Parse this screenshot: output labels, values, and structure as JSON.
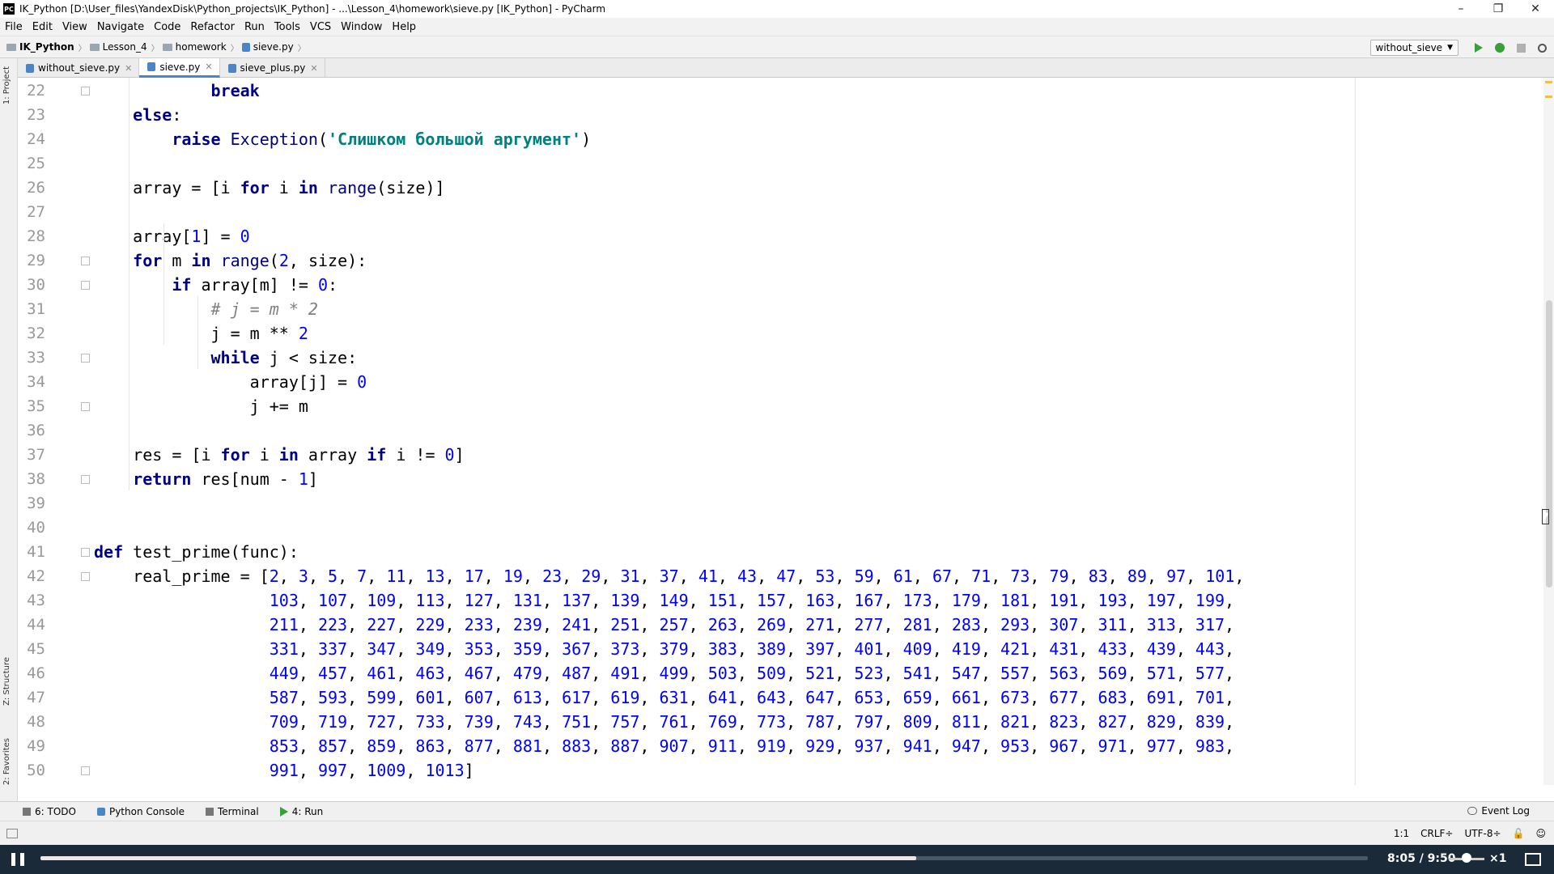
{
  "window": {
    "app_icon": "PC",
    "title": "IK_Python [D:\\User_files\\YandexDisk\\Python_projects\\IK_Python] - ...\\Lesson_4\\homework\\sieve.py [IK_Python] - PyCharm",
    "minimize": "–",
    "restore": "❐",
    "close": "✕"
  },
  "menu": [
    "File",
    "Edit",
    "View",
    "Navigate",
    "Code",
    "Refactor",
    "Run",
    "Tools",
    "VCS",
    "Window",
    "Help"
  ],
  "breadcrumb": {
    "items": [
      "IK_Python",
      "Lesson_4",
      "homework",
      "sieve.py"
    ]
  },
  "run_config": {
    "label": "without_sieve"
  },
  "tabs": [
    {
      "label": "without_sieve.py",
      "active": false
    },
    {
      "label": "sieve.py",
      "active": true
    },
    {
      "label": "sieve_plus.py",
      "active": false
    }
  ],
  "side_panels": {
    "project": "1: Project",
    "structure": "Z: Structure",
    "favorites": "2: Favorites"
  },
  "code_lines": [
    {
      "n": "22",
      "html": "                <span class=\"kw\">break</span>"
    },
    {
      "n": "23",
      "html": "        <span class=\"kw\">else</span>:"
    },
    {
      "n": "24",
      "html": "            <span class=\"kw\">raise</span> <span class=\"bi\">Exception</span>(<span class=\"str\">'Слишком большой аргумент'</span>)"
    },
    {
      "n": "25",
      "html": ""
    },
    {
      "n": "26",
      "html": "        array = [i <span class=\"kw\">for</span> i <span class=\"kw\">in</span> <span class=\"bi\">range</span>(size)]"
    },
    {
      "n": "27",
      "html": ""
    },
    {
      "n": "28",
      "html": "        array[<span class=\"num\">1</span>] = <span class=\"num\">0</span>"
    },
    {
      "n": "29",
      "html": "        <span class=\"kw\">for</span> m <span class=\"kw\">in</span> <span class=\"bi\">range</span>(<span class=\"num\">2</span>, size):"
    },
    {
      "n": "30",
      "html": "            <span class=\"kw\">if</span> array[m] != <span class=\"num\">0</span>:"
    },
    {
      "n": "31",
      "html": "                <span class=\"cmt\"># j = m * 2</span>"
    },
    {
      "n": "32",
      "html": "                j = m ** <span class=\"num\">2</span>"
    },
    {
      "n": "33",
      "html": "                <span class=\"kw\">while</span> j &lt; size:"
    },
    {
      "n": "34",
      "html": "                    array[j] = <span class=\"num\">0</span>"
    },
    {
      "n": "35",
      "html": "                    j += m"
    },
    {
      "n": "36",
      "html": ""
    },
    {
      "n": "37",
      "html": "        res = [i <span class=\"kw\">for</span> i <span class=\"kw\">in</span> array <span class=\"kw\">if</span> i != <span class=\"num\">0</span>]"
    },
    {
      "n": "38",
      "html": "        <span class=\"kw\">return</span> res[num - <span class=\"num\">1</span>]"
    },
    {
      "n": "39",
      "html": ""
    },
    {
      "n": "40",
      "html": ""
    },
    {
      "n": "41",
      "html": "    <span class=\"kw\">def</span> test_prime(func):"
    },
    {
      "n": "42",
      "html": "        real_prime = [<span class=\"num\">2</span>, <span class=\"num\">3</span>, <span class=\"num\">5</span>, <span class=\"num\">7</span>, <span class=\"num\">11</span>, <span class=\"num\">13</span>, <span class=\"num\">17</span>, <span class=\"num\">19</span>, <span class=\"num\">23</span>, <span class=\"num\">29</span>, <span class=\"num\">31</span>, <span class=\"num\">37</span>, <span class=\"num\">41</span>, <span class=\"num\">43</span>, <span class=\"num\">47</span>, <span class=\"num\">53</span>, <span class=\"num\">59</span>, <span class=\"num\">61</span>, <span class=\"num\">67</span>, <span class=\"num\">71</span>, <span class=\"num\">73</span>, <span class=\"num\">79</span>, <span class=\"num\">83</span>, <span class=\"num\">89</span>, <span class=\"num\">97</span>, <span class=\"num\">101</span>,"
    },
    {
      "n": "43",
      "html": "                      <span class=\"num\">103</span>, <span class=\"num\">107</span>, <span class=\"num\">109</span>, <span class=\"num\">113</span>, <span class=\"num\">127</span>, <span class=\"num\">131</span>, <span class=\"num\">137</span>, <span class=\"num\">139</span>, <span class=\"num\">149</span>, <span class=\"num\">151</span>, <span class=\"num\">157</span>, <span class=\"num\">163</span>, <span class=\"num\">167</span>, <span class=\"num\">173</span>, <span class=\"num\">179</span>, <span class=\"num\">181</span>, <span class=\"num\">191</span>, <span class=\"num\">193</span>, <span class=\"num\">197</span>, <span class=\"num\">199</span>,"
    },
    {
      "n": "44",
      "html": "                      <span class=\"num\">211</span>, <span class=\"num\">223</span>, <span class=\"num\">227</span>, <span class=\"num\">229</span>, <span class=\"num\">233</span>, <span class=\"num\">239</span>, <span class=\"num\">241</span>, <span class=\"num\">251</span>, <span class=\"num\">257</span>, <span class=\"num\">263</span>, <span class=\"num\">269</span>, <span class=\"num\">271</span>, <span class=\"num\">277</span>, <span class=\"num\">281</span>, <span class=\"num\">283</span>, <span class=\"num\">293</span>, <span class=\"num\">307</span>, <span class=\"num\">311</span>, <span class=\"num\">313</span>, <span class=\"num\">317</span>,"
    },
    {
      "n": "45",
      "html": "                      <span class=\"num\">331</span>, <span class=\"num\">337</span>, <span class=\"num\">347</span>, <span class=\"num\">349</span>, <span class=\"num\">353</span>, <span class=\"num\">359</span>, <span class=\"num\">367</span>, <span class=\"num\">373</span>, <span class=\"num\">379</span>, <span class=\"num\">383</span>, <span class=\"num\">389</span>, <span class=\"num\">397</span>, <span class=\"num\">401</span>, <span class=\"num\">409</span>, <span class=\"num\">419</span>, <span class=\"num\">421</span>, <span class=\"num\">431</span>, <span class=\"num\">433</span>, <span class=\"num\">439</span>, <span class=\"num\">443</span>,"
    },
    {
      "n": "46",
      "html": "                      <span class=\"num\">449</span>, <span class=\"num\">457</span>, <span class=\"num\">461</span>, <span class=\"num\">463</span>, <span class=\"num\">467</span>, <span class=\"num\">479</span>, <span class=\"num\">487</span>, <span class=\"num\">491</span>, <span class=\"num\">499</span>, <span class=\"num\">503</span>, <span class=\"num\">509</span>, <span class=\"num\">521</span>, <span class=\"num\">523</span>, <span class=\"num\">541</span>, <span class=\"num\">547</span>, <span class=\"num\">557</span>, <span class=\"num\">563</span>, <span class=\"num\">569</span>, <span class=\"num\">571</span>, <span class=\"num\">577</span>,"
    },
    {
      "n": "47",
      "html": "                      <span class=\"num\">587</span>, <span class=\"num\">593</span>, <span class=\"num\">599</span>, <span class=\"num\">601</span>, <span class=\"num\">607</span>, <span class=\"num\">613</span>, <span class=\"num\">617</span>, <span class=\"num\">619</span>, <span class=\"num\">631</span>, <span class=\"num\">641</span>, <span class=\"num\">643</span>, <span class=\"num\">647</span>, <span class=\"num\">653</span>, <span class=\"num\">659</span>, <span class=\"num\">661</span>, <span class=\"num\">673</span>, <span class=\"num\">677</span>, <span class=\"num\">683</span>, <span class=\"num\">691</span>, <span class=\"num\">701</span>,"
    },
    {
      "n": "48",
      "html": "                      <span class=\"num\">709</span>, <span class=\"num\">719</span>, <span class=\"num\">727</span>, <span class=\"num\">733</span>, <span class=\"num\">739</span>, <span class=\"num\">743</span>, <span class=\"num\">751</span>, <span class=\"num\">757</span>, <span class=\"num\">761</span>, <span class=\"num\">769</span>, <span class=\"num\">773</span>, <span class=\"num\">787</span>, <span class=\"num\">797</span>, <span class=\"num\">809</span>, <span class=\"num\">811</span>, <span class=\"num\">821</span>, <span class=\"num\">823</span>, <span class=\"num\">827</span>, <span class=\"num\">829</span>, <span class=\"num\">839</span>,"
    },
    {
      "n": "49",
      "html": "                      <span class=\"num\">853</span>, <span class=\"num\">857</span>, <span class=\"num\">859</span>, <span class=\"num\">863</span>, <span class=\"num\">877</span>, <span class=\"num\">881</span>, <span class=\"num\">883</span>, <span class=\"num\">887</span>, <span class=\"num\">907</span>, <span class=\"num\">911</span>, <span class=\"num\">919</span>, <span class=\"num\">929</span>, <span class=\"num\">937</span>, <span class=\"num\">941</span>, <span class=\"num\">947</span>, <span class=\"num\">953</span>, <span class=\"num\">967</span>, <span class=\"num\">971</span>, <span class=\"num\">977</span>, <span class=\"num\">983</span>,"
    },
    {
      "n": "50",
      "html": "                      <span class=\"num\">991</span>, <span class=\"num\">997</span>, <span class=\"num\">1009</span>, <span class=\"num\">1013</span>]"
    }
  ],
  "bottom_tools": [
    {
      "label": "6: TODO",
      "icon": "todo-icon"
    },
    {
      "label": "Python Console",
      "icon": "python-console-icon"
    },
    {
      "label": "Terminal",
      "icon": "terminal-icon"
    },
    {
      "label": "4: Run",
      "icon": "run-icon"
    }
  ],
  "event_log": "Event Log",
  "status": {
    "position": "1:1",
    "line_sep": "CRLF÷",
    "encoding": "UTF-8÷"
  },
  "video": {
    "time": "8:05 / 9:50",
    "speed": "×1",
    "progress": 0.66
  }
}
